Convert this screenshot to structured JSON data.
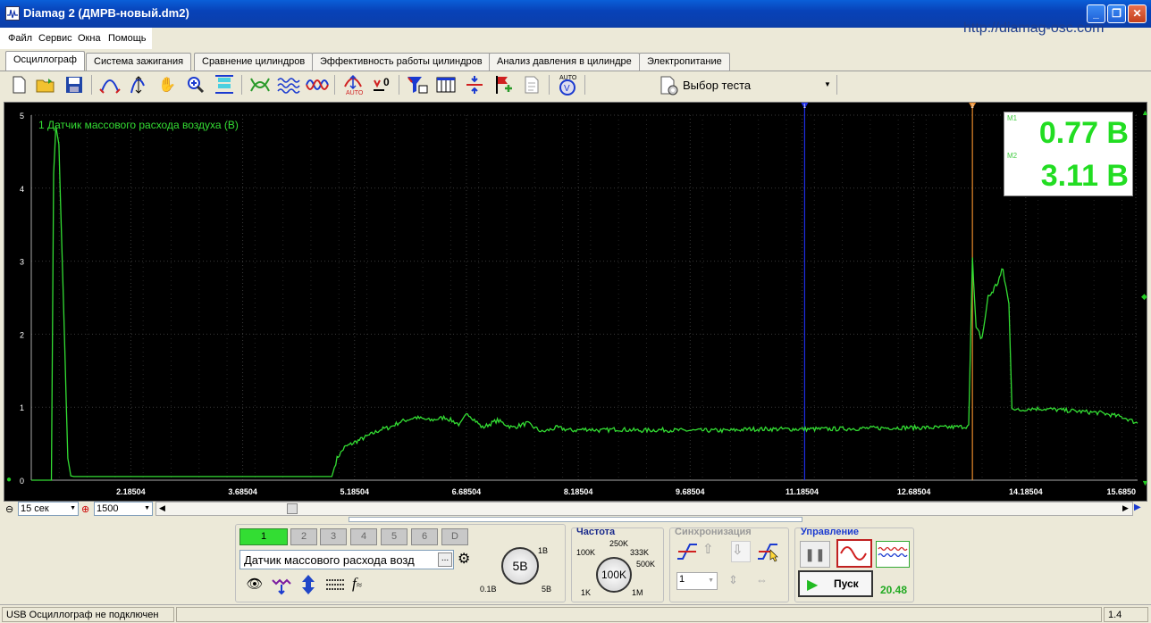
{
  "window": {
    "title": "Diamag 2 (ДМРВ-новый.dm2)",
    "url": "http://diamag-osc.com"
  },
  "menu": [
    "Файл",
    "Сервис",
    "Окна",
    "Помощь"
  ],
  "tabs": [
    {
      "label": "Осциллограф",
      "active": true
    },
    {
      "label": "Система зажигания"
    },
    {
      "label": "Сравнение цилиндров"
    },
    {
      "label": "Эффективность работы цилиндров"
    },
    {
      "label": "Анализ давления в цилиндре"
    },
    {
      "label": "Электропитание"
    }
  ],
  "toolbar": {
    "test_select": "Выбор теста",
    "icons": [
      "new-file-icon",
      "open-folder-icon",
      "save-icon",
      "curve-icon",
      "vertical-scale-icon",
      "hand-icon",
      "zoom-icon",
      "stack-icon",
      "cross-wave-icon",
      "multi-wave-icon",
      "overlap-wave-icon",
      "auto-scale-icon",
      "zero-icon",
      "filter-icon",
      "columns-icon",
      "split-icon",
      "flag-add-icon",
      "page-icon",
      "auto-meter-icon"
    ]
  },
  "plot": {
    "channel_label": "1 Датчик массового расхода воздуха (В)",
    "y_ticks": [
      "5",
      "4",
      "3",
      "2",
      "1",
      "0"
    ],
    "x_ticks": [
      "2.18504",
      "3.68504",
      "5.18504",
      "6.68504",
      "8.18504",
      "9.68504",
      "11.18504",
      "12.68504",
      "14.18504",
      "15.6850"
    ],
    "marker1_label": "1",
    "marker2_label": "2",
    "m1_label": "M1",
    "m2_label": "M2",
    "m1_value": "0.77 В",
    "m2_value": "3.11 В"
  },
  "chart_data": {
    "type": "line",
    "xlabel": "",
    "ylabel": "",
    "ylim": [
      0,
      5
    ],
    "xlim": [
      0.85,
      15.685
    ],
    "series": [
      {
        "color": "#33dd33",
        "x": [
          0.85,
          1.12,
          1.15,
          1.18,
          1.22,
          1.28,
          1.34,
          1.38,
          1.42,
          1.5,
          1.8,
          3.0,
          4.0,
          4.6,
          4.88,
          4.95,
          5.05,
          5.15,
          5.25,
          5.35,
          5.45,
          5.55,
          5.65,
          5.8,
          6.0,
          6.2,
          6.4,
          6.6,
          6.7,
          6.9,
          7.1,
          7.3,
          7.5,
          7.7,
          7.9,
          8.1,
          8.3,
          8.5,
          8.7,
          9.0,
          9.3,
          9.6,
          9.9,
          10.2,
          10.5,
          10.8,
          11.1,
          11.5,
          12.0,
          12.5,
          13.0,
          13.3,
          13.42,
          13.47,
          13.52,
          13.6,
          13.68,
          13.78,
          13.88,
          13.96,
          14.0,
          14.1,
          14.2,
          14.4,
          14.8,
          15.2,
          15.5,
          15.685
        ],
        "values": [
          0.0,
          0.0,
          4.2,
          4.85,
          4.6,
          2.5,
          0.3,
          0.06,
          0.05,
          0.05,
          0.05,
          0.05,
          0.05,
          0.05,
          0.05,
          0.3,
          0.45,
          0.5,
          0.55,
          0.6,
          0.65,
          0.7,
          0.72,
          0.8,
          0.86,
          0.82,
          0.86,
          0.76,
          0.92,
          0.72,
          0.82,
          0.72,
          0.78,
          0.66,
          0.72,
          0.68,
          0.7,
          0.68,
          0.7,
          0.68,
          0.69,
          0.68,
          0.68,
          0.68,
          0.7,
          0.7,
          0.7,
          0.7,
          0.71,
          0.72,
          0.72,
          0.73,
          0.74,
          3.05,
          2.05,
          1.95,
          2.5,
          2.65,
          2.88,
          2.4,
          1.0,
          0.95,
          0.98,
          0.98,
          0.95,
          0.92,
          0.86,
          0.78
        ]
      }
    ],
    "markers": [
      {
        "name": "M1",
        "x": 11.22,
        "color": "#1e2ee6"
      },
      {
        "name": "M2",
        "x": 13.47,
        "color": "#e88a2a"
      }
    ]
  },
  "scroll": {
    "timebase": "15 сек",
    "points": "1500"
  },
  "channels": {
    "buttons": [
      "1",
      "2",
      "3",
      "4",
      "5",
      "6",
      "D"
    ],
    "active": "1",
    "sensor_name": "Датчик массового расхода возд",
    "browse_label": "...",
    "voltage_knob": {
      "value": "5В",
      "min_label": "0.1В",
      "max_label": "5В",
      "top_label": "1В"
    }
  },
  "frequency": {
    "title": "Частота",
    "value": "100K",
    "labels": [
      "100K",
      "250K",
      "333K",
      "500K",
      "1K",
      "1M"
    ]
  },
  "sync": {
    "title": "Синхронизация",
    "channel": "1"
  },
  "control": {
    "title": "Управление",
    "start_label": "Пуск",
    "time_value": "20.48"
  },
  "status": {
    "message": "USB Осциллограф не подключен",
    "version": "1.4"
  }
}
